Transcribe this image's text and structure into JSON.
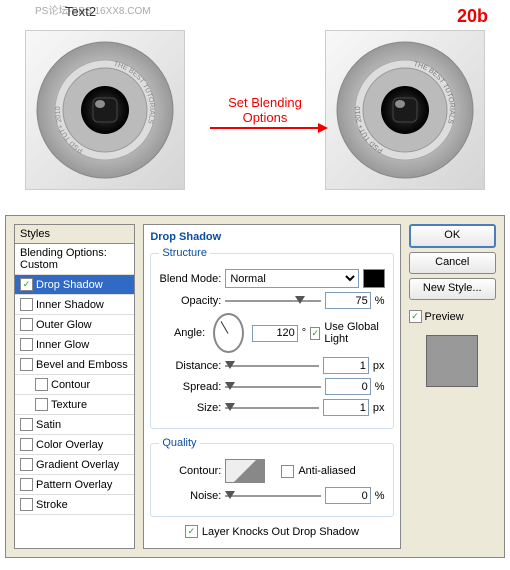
{
  "header": {
    "label": "Text2",
    "step": "20b",
    "watermark": "PS论坛-BBS.16XX8.COM",
    "arrow": "Set Blending Options",
    "ring1": "THE BEST TUTORIALS",
    "ring2": "PSD TUT+ 2010"
  },
  "styles": {
    "header": "Styles",
    "blending": "Blending Options: Custom",
    "items": [
      {
        "id": "drop-shadow",
        "label": "Drop Shadow",
        "checked": true,
        "selected": true,
        "indent": false
      },
      {
        "id": "inner-shadow",
        "label": "Inner Shadow",
        "checked": false,
        "selected": false,
        "indent": false
      },
      {
        "id": "outer-glow",
        "label": "Outer Glow",
        "checked": false,
        "selected": false,
        "indent": false
      },
      {
        "id": "inner-glow",
        "label": "Inner Glow",
        "checked": false,
        "selected": false,
        "indent": false
      },
      {
        "id": "bevel",
        "label": "Bevel and Emboss",
        "checked": false,
        "selected": false,
        "indent": false
      },
      {
        "id": "contour",
        "label": "Contour",
        "checked": false,
        "selected": false,
        "indent": true
      },
      {
        "id": "texture",
        "label": "Texture",
        "checked": false,
        "selected": false,
        "indent": true
      },
      {
        "id": "satin",
        "label": "Satin",
        "checked": false,
        "selected": false,
        "indent": false
      },
      {
        "id": "color-overlay",
        "label": "Color Overlay",
        "checked": false,
        "selected": false,
        "indent": false
      },
      {
        "id": "gradient-overlay",
        "label": "Gradient Overlay",
        "checked": false,
        "selected": false,
        "indent": false
      },
      {
        "id": "pattern-overlay",
        "label": "Pattern Overlay",
        "checked": false,
        "selected": false,
        "indent": false
      },
      {
        "id": "stroke",
        "label": "Stroke",
        "checked": false,
        "selected": false,
        "indent": false
      }
    ]
  },
  "panel": {
    "title": "Drop Shadow",
    "structure": "Structure",
    "quality": "Quality",
    "blendmode_label": "Blend Mode:",
    "blendmode": "Normal",
    "opacity_label": "Opacity:",
    "opacity": "75",
    "pct": "%",
    "angle_label": "Angle:",
    "angle": "120",
    "deg": "°",
    "global": "Use Global Light",
    "distance_label": "Distance:",
    "distance": "1",
    "px": "px",
    "spread_label": "Spread:",
    "spread": "0",
    "size_label": "Size:",
    "size": "1",
    "contour_label": "Contour:",
    "anti": "Anti-aliased",
    "noise_label": "Noise:",
    "noise": "0",
    "knockout": "Layer Knocks Out Drop Shadow"
  },
  "side": {
    "ok": "OK",
    "cancel": "Cancel",
    "newstyle": "New Style...",
    "preview": "Preview"
  }
}
